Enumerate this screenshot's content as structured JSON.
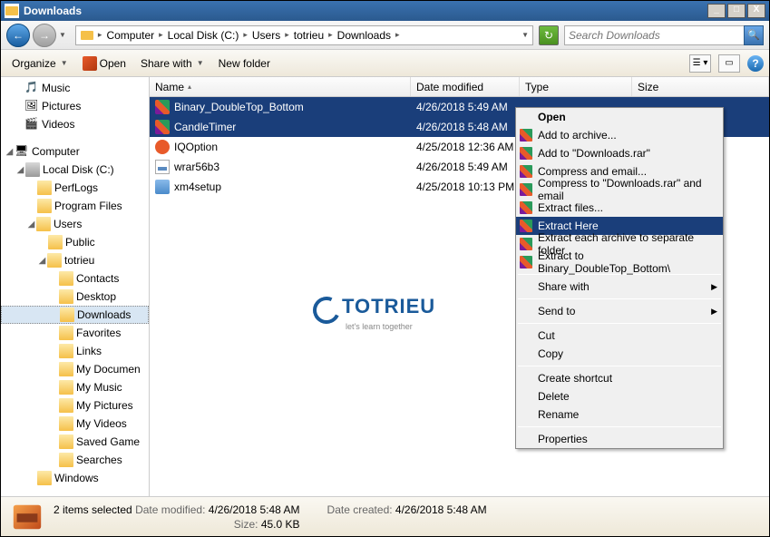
{
  "window": {
    "title": "Downloads"
  },
  "breadcrumb": {
    "segments": [
      "Computer",
      "Local Disk (C:)",
      "Users",
      "totrieu",
      "Downloads"
    ]
  },
  "search": {
    "placeholder": "Search Downloads"
  },
  "toolbar": {
    "organize": "Organize",
    "open": "Open",
    "sharewith": "Share with",
    "newfolder": "New folder"
  },
  "columns": {
    "name": "Name",
    "date": "Date modified",
    "type": "Type",
    "size": "Size"
  },
  "tree": {
    "music": "Music",
    "pictures": "Pictures",
    "videos": "Videos",
    "computer": "Computer",
    "localdisk": "Local Disk (C:)",
    "perflogs": "PerfLogs",
    "programfiles": "Program Files",
    "users": "Users",
    "public": "Public",
    "totrieu": "totrieu",
    "contacts": "Contacts",
    "desktop": "Desktop",
    "downloads": "Downloads",
    "favorites": "Favorites",
    "links": "Links",
    "mydocuments": "My Documen",
    "mymusic": "My Music",
    "mypictures": "My Pictures",
    "myvideos": "My Videos",
    "savedgame": "Saved Game",
    "searches": "Searches",
    "windows": "Windows"
  },
  "files": [
    {
      "name": "Binary_DoubleTop_Bottom",
      "date": "4/26/2018 5:49 AM",
      "icon": "rar",
      "selected": true
    },
    {
      "name": "CandleTimer",
      "date": "4/26/2018 5:48 AM",
      "icon": "rar",
      "selected": true
    },
    {
      "name": "IQOption",
      "date": "4/25/2018 12:36 AM",
      "icon": "iq",
      "selected": false
    },
    {
      "name": "wrar56b3",
      "date": "4/26/2018 5:49 AM",
      "icon": "exe",
      "selected": false
    },
    {
      "name": "xm4setup",
      "date": "4/25/2018 10:13 PM",
      "icon": "xm",
      "selected": false
    }
  ],
  "watermark": {
    "big": "TOTRIEU",
    "small": "let's learn together"
  },
  "context": {
    "open": "Open",
    "addarchive": "Add to archive...",
    "addto": "Add to \"Downloads.rar\"",
    "compressemail": "Compress and email...",
    "compressto": "Compress to \"Downloads.rar\" and email",
    "extractfiles": "Extract files...",
    "extracthere": "Extract Here",
    "extracteach": "Extract each archive to separate folder",
    "extractto": "Extract to Binary_DoubleTop_Bottom\\",
    "sharewith": "Share with",
    "sendto": "Send to",
    "cut": "Cut",
    "copy": "Copy",
    "createshortcut": "Create shortcut",
    "delete": "Delete",
    "rename": "Rename",
    "properties": "Properties"
  },
  "status": {
    "selected": "2 items selected",
    "modified_label": "Date modified:",
    "modified_value": "4/26/2018 5:48 AM",
    "size_label": "Size:",
    "size_value": "45.0 KB",
    "created_label": "Date created:",
    "created_value": "4/26/2018 5:48 AM"
  }
}
